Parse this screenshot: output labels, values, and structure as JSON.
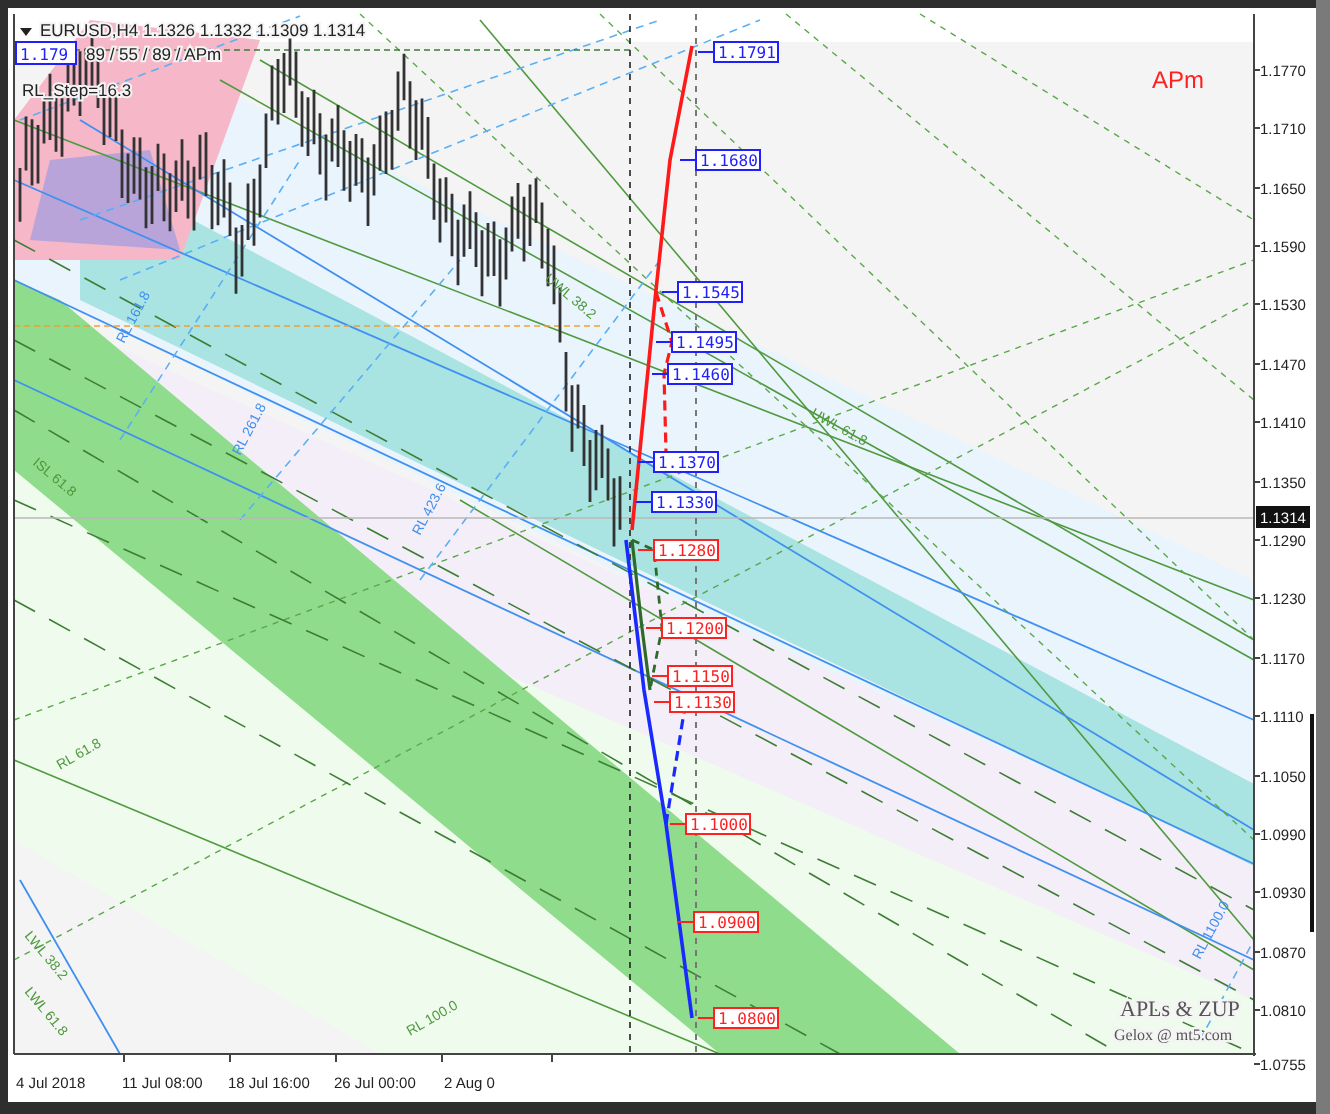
{
  "chart": {
    "symbol_line": "EURUSD,H4  1.1326 1.1332 1.1309 1.1314",
    "left_price_tag": "1.179",
    "params": "89 / 55 / 89 / APm",
    "step": "RL_Step=16.3",
    "corner_label": "APm",
    "price_axis": [
      "1.1770",
      "1.1710",
      "1.1650",
      "1.1590",
      "1.1530",
      "1.1470",
      "1.1410",
      "1.1350",
      "1.1290",
      "1.1230",
      "1.1170",
      "1.1110",
      "1.1050",
      "1.0990",
      "1.0930",
      "1.0870",
      "1.0810",
      "1.0755"
    ],
    "current_price": "1.1314",
    "time_axis": [
      "4 Jul 2018",
      "11 Jul 08:00",
      "18 Jul 16:00",
      "26 Jul 00:00",
      "2 Aug 0"
    ],
    "targets": [
      {
        "label": "1.1791",
        "kind": "up"
      },
      {
        "label": "1.1680",
        "kind": "up"
      },
      {
        "label": "1.1545",
        "kind": "up"
      },
      {
        "label": "1.1495",
        "kind": "up"
      },
      {
        "label": "1.1460",
        "kind": "up"
      },
      {
        "label": "1.1370",
        "kind": "up"
      },
      {
        "label": "1.1330",
        "kind": "up"
      },
      {
        "label": "1.1280",
        "kind": "down"
      },
      {
        "label": "1.1200",
        "kind": "down"
      },
      {
        "label": "1.1150",
        "kind": "down"
      },
      {
        "label": "1.1130",
        "kind": "down"
      },
      {
        "label": "1.1000",
        "kind": "down"
      },
      {
        "label": "1.0900",
        "kind": "down"
      },
      {
        "label": "1.0800",
        "kind": "down"
      }
    ],
    "line_labels": [
      "UWL 61.8",
      "UWL 38.2",
      "RL 161.8",
      "RL 261.8",
      "RL 423.6",
      "ISL 61.8",
      "RL 61.8",
      "RL 100.0",
      "LWL 38.2",
      "LWL 61.8",
      "RL 1100.0"
    ],
    "credits": [
      "APLs & ZUP",
      "Gelox @ mt5.com"
    ]
  }
}
